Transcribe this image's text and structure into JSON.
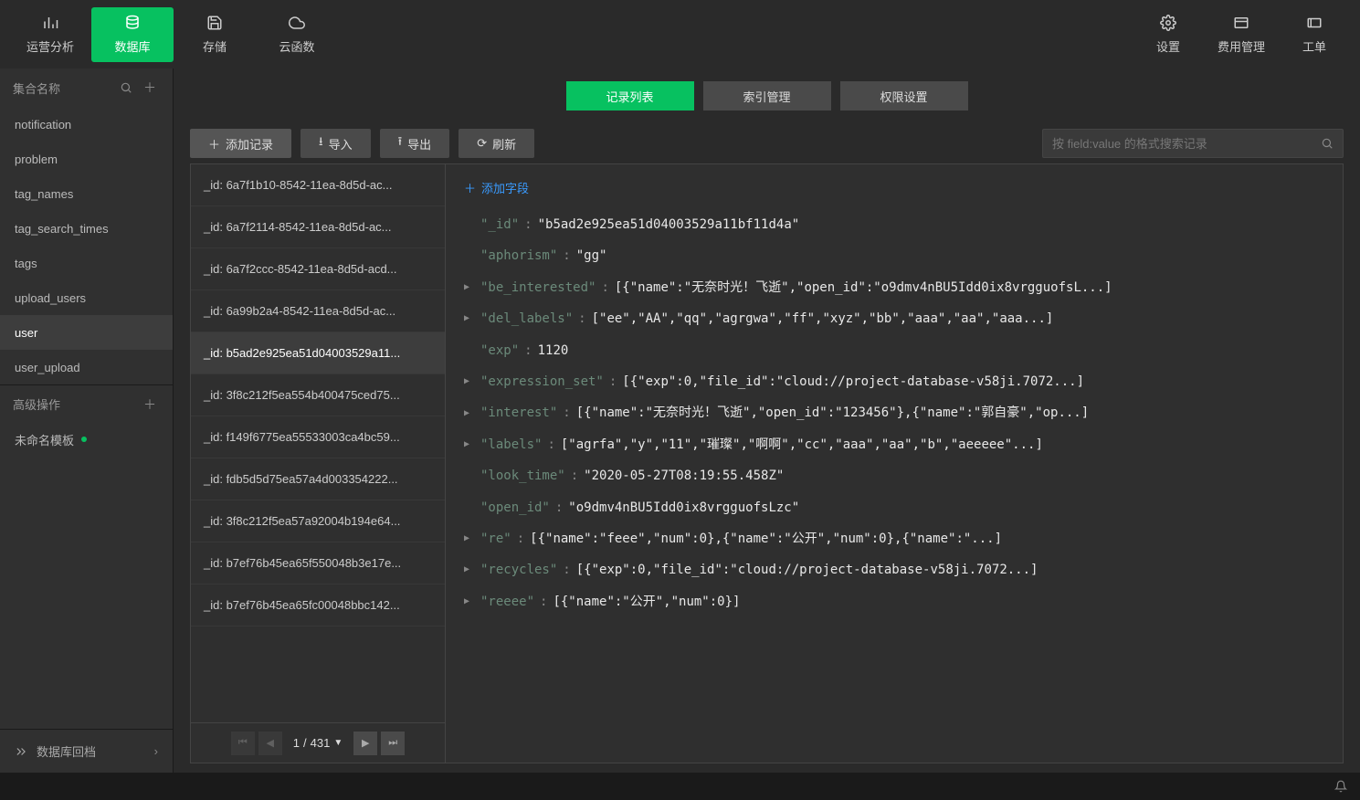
{
  "topnav": {
    "left": [
      {
        "icon": "bars",
        "label": "运营分析"
      },
      {
        "icon": "db",
        "label": "数据库",
        "active": true
      },
      {
        "icon": "save",
        "label": "存储"
      },
      {
        "icon": "cloud",
        "label": "云函数"
      }
    ],
    "right": [
      {
        "icon": "gear",
        "label": "设置"
      },
      {
        "icon": "layout",
        "label": "费用管理"
      },
      {
        "icon": "ticket",
        "label": "工单"
      }
    ]
  },
  "sidebar": {
    "collections_header": "集合名称",
    "collections": [
      "notification",
      "problem",
      "tag_names",
      "tag_search_times",
      "tags",
      "upload_users",
      "user",
      "user_upload"
    ],
    "selected_collection": "user",
    "advanced_header": "高级操作",
    "advanced_items": [
      {
        "label": "未命名模板",
        "status": "ok"
      }
    ],
    "footer_label": "数据库回档"
  },
  "tabs": [
    {
      "label": "记录列表",
      "active": true
    },
    {
      "label": "索引管理"
    },
    {
      "label": "权限设置"
    }
  ],
  "toolbar": {
    "add_label": "添加记录",
    "import_label": "导入",
    "export_label": "导出",
    "refresh_label": "刷新",
    "search_placeholder": "按 field:value 的格式搜索记录"
  },
  "records": [
    "_id: 6a7f1b10-8542-11ea-8d5d-ac...",
    "_id: 6a7f2114-8542-11ea-8d5d-ac...",
    "_id: 6a7f2ccc-8542-11ea-8d5d-acd...",
    "_id: 6a99b2a4-8542-11ea-8d5d-ac...",
    "_id: b5ad2e925ea51d04003529a11...",
    "_id: 3f8c212f5ea554b400475ced75...",
    "_id: f149f6775ea55533003ca4bc59...",
    "_id: fdb5d5d75ea57a4d003354222...",
    "_id: 3f8c212f5ea57a92004b194e64...",
    "_id: b7ef76b45ea65f550048b3e17e...",
    "_id: b7ef76b45ea65fc00048bbc142..."
  ],
  "selected_record_index": 4,
  "pager": {
    "page": "1",
    "total": "431",
    "sep": "/"
  },
  "add_field_label": "添加字段",
  "document": [
    {
      "expand": false,
      "key": "\"_id\"",
      "value": "\"b5ad2e925ea51d04003529a11bf11d4a\"",
      "type": "str"
    },
    {
      "expand": false,
      "key": "\"aphorism\"",
      "value": "\"gg\"",
      "type": "str"
    },
    {
      "expand": true,
      "key": "\"be_interested\"",
      "value": "[{\"name\":\"无奈时光！飞逝\",\"open_id\":\"o9dmv4nBU5Idd0ix8vrgguofsL...]",
      "type": "json"
    },
    {
      "expand": true,
      "key": "\"del_labels\"",
      "value": "[\"ee\",\"AA\",\"qq\",\"agrgwa\",\"ff\",\"xyz\",\"bb\",\"aaa\",\"aa\",\"aaa...]",
      "type": "json"
    },
    {
      "expand": false,
      "key": "\"exp\"",
      "value": "1120",
      "type": "num"
    },
    {
      "expand": true,
      "key": "\"expression_set\"",
      "value": "[{\"exp\":0,\"file_id\":\"cloud://project-database-v58ji.7072...]",
      "type": "json"
    },
    {
      "expand": true,
      "key": "\"interest\"",
      "value": "[{\"name\":\"无奈时光！飞逝\",\"open_id\":\"123456\"},{\"name\":\"郭自豪\",\"op...]",
      "type": "json"
    },
    {
      "expand": true,
      "key": "\"labels\"",
      "value": "[\"agrfa\",\"y\",\"11\",\"璀璨\",\"啊啊\",\"cc\",\"aaa\",\"aa\",\"b\",\"aeeeee\"...]",
      "type": "json"
    },
    {
      "expand": false,
      "key": "\"look_time\"",
      "value": "\"2020-05-27T08:19:55.458Z\"",
      "type": "str"
    },
    {
      "expand": false,
      "key": "\"open_id\"",
      "value": "\"o9dmv4nBU5Idd0ix8vrgguofsLzc\"",
      "type": "str"
    },
    {
      "expand": true,
      "key": "\"re\"",
      "value": "[{\"name\":\"feee\",\"num\":0},{\"name\":\"公开\",\"num\":0},{\"name\":\"...]",
      "type": "json"
    },
    {
      "expand": true,
      "key": "\"recycles\"",
      "value": "[{\"exp\":0,\"file_id\":\"cloud://project-database-v58ji.7072...]",
      "type": "json"
    },
    {
      "expand": true,
      "key": "\"reeee\"",
      "value": "[{\"name\":\"公开\",\"num\":0}]",
      "type": "json"
    }
  ]
}
